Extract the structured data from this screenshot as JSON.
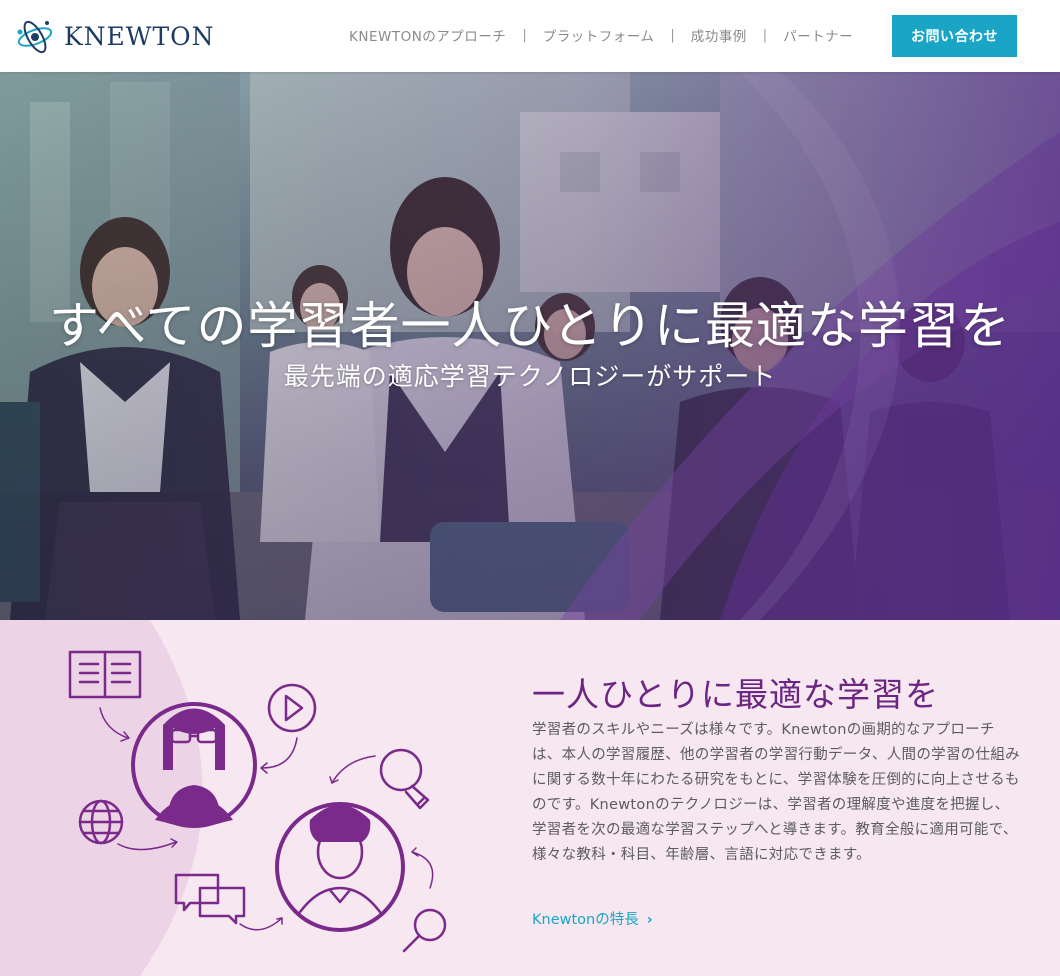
{
  "header": {
    "logo_text": "KNEWTON",
    "nav": [
      {
        "label": "KNEWTONのアプローチ"
      },
      {
        "label": "プラットフォーム"
      },
      {
        "label": "成功事例"
      },
      {
        "label": "パートナー"
      }
    ],
    "separator": "|",
    "contact_label": "お問い合わせ"
  },
  "hero": {
    "title": "すべての学習者一人ひとりに最適な学習を",
    "subtitle": "最先端の適応学習テクノロジーがサポート"
  },
  "feature": {
    "title": "一人ひとりに最適な学習を",
    "body": "学習者のスキルやニーズは様々です。Knewtonの画期的なアプローチは、本人の学習履歴、他の学習者の学習行動データ、人間の学習の仕組みに関する数十年にわたる研究をもとに、学習体験を圧倒的に向上させるものです。Knewtonのテクノロジーは、学習者の理解度や進度を把握し、学習者を次の最適な学習ステップへと導きます。教育全般に適用可能で、様々な教科・科目、年齢層、言語に対応できます。",
    "link_label": "Knewtonの特長",
    "link_chevron": "›"
  },
  "colors": {
    "accent": "#1aa5c6",
    "purple": "#6c2582",
    "feature_bg": "#f6e7f1",
    "logo": "#1f3d63"
  },
  "icons": [
    "knewton-atom-logo",
    "book-icon",
    "play-icon",
    "globe-icon",
    "lightbulb-icon",
    "chat-icon",
    "magnifier-icon",
    "learner-avatar-glasses",
    "learner-avatar-student"
  ]
}
